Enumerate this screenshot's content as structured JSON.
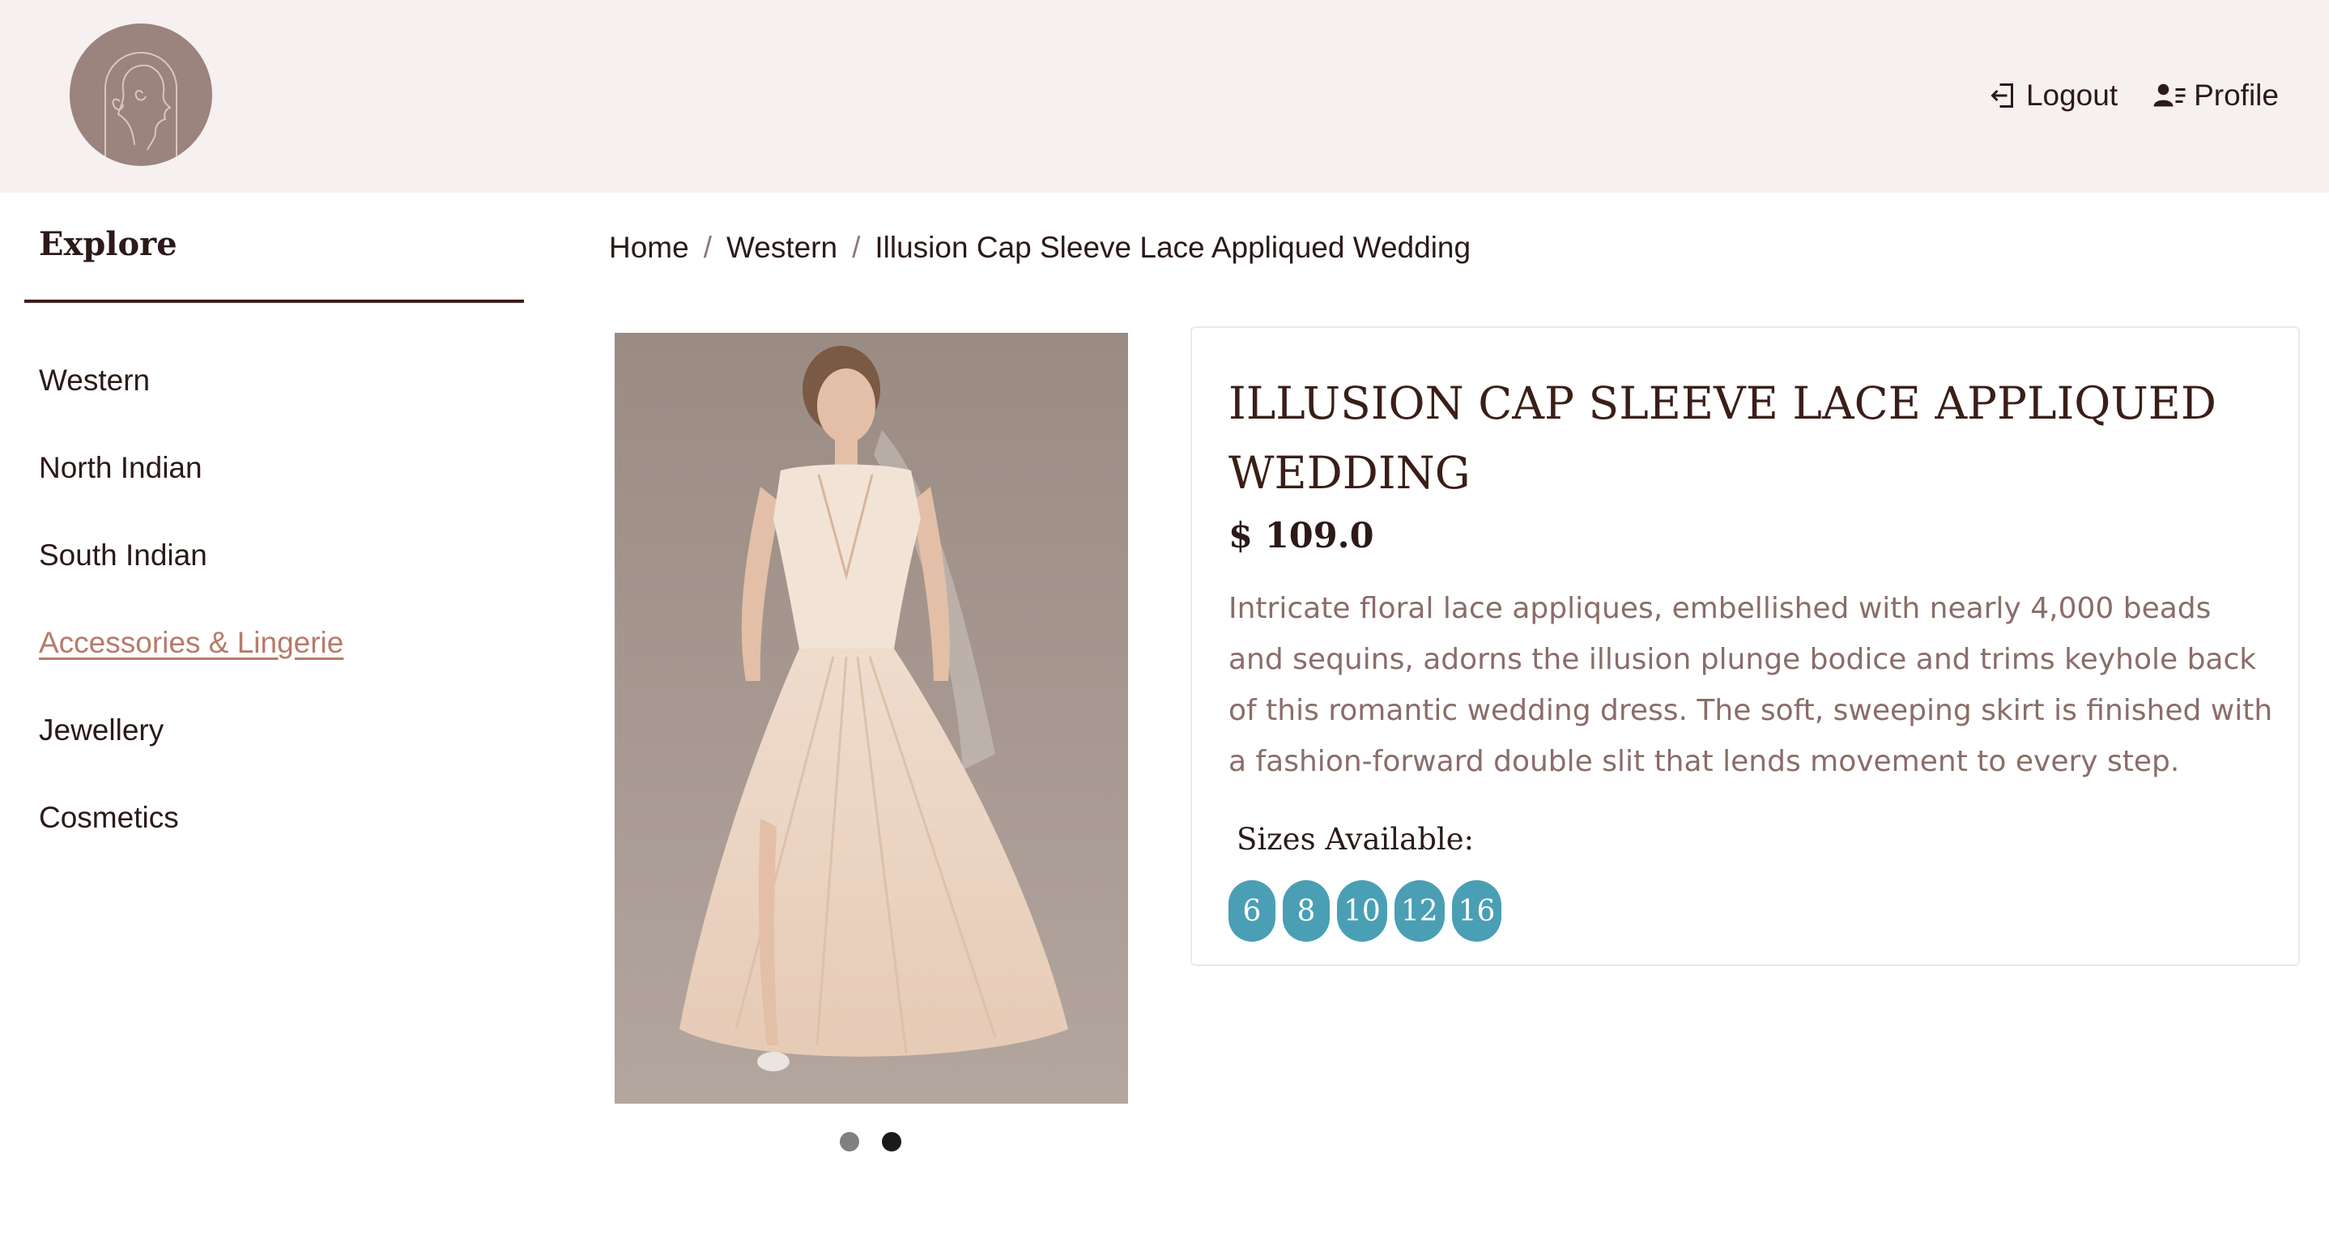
{
  "header": {
    "logout_label": "Logout",
    "profile_label": "Profile"
  },
  "sidebar": {
    "title": "Explore",
    "items": [
      {
        "label": "Western"
      },
      {
        "label": "North Indian"
      },
      {
        "label": "South Indian"
      },
      {
        "label": "Accessories & Lingerie",
        "active": true
      },
      {
        "label": "Jewellery"
      },
      {
        "label": "Cosmetics"
      }
    ]
  },
  "breadcrumb": {
    "items": [
      "Home",
      "Western",
      "Illusion Cap Sleeve Lace Appliqued Wedding"
    ],
    "separator": "/"
  },
  "product": {
    "title": "ILLUSION CAP SLEEVE LACE APPLIQUED WEDDING",
    "price": "$ 109.0",
    "description": "Intricate floral lace appliques, embellished with nearly 4,000 beads and sequins, adorns the illusion plunge bodice and trims keyhole back of this romantic wedding dress. The soft, sweeping skirt is finished with a fashion-forward double slit that lends movement to every step.",
    "sizes_label": "Sizes Available:",
    "sizes": [
      "6",
      "8",
      "10",
      "12",
      "16"
    ]
  },
  "carousel": {
    "slide_count": 2,
    "active_index": 1
  },
  "colors": {
    "header_bg": "#f6f0f0",
    "accent_active_link": "#b87a6b",
    "size_pill": "#4a9fb5",
    "text_dark": "#2b1a17",
    "description_text": "#8a6d68"
  }
}
